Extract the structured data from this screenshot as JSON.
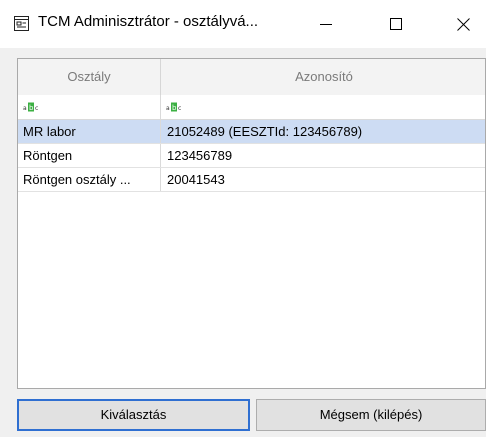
{
  "window": {
    "title": "TCM Adminisztrátor - osztályvá...",
    "icon": "app-window-icon",
    "controls": {
      "minimize": "minimize-icon",
      "maximize": "maximize-icon",
      "close": "close-icon"
    }
  },
  "grid": {
    "columns": [
      "Osztály",
      "Azonosító"
    ],
    "filter_icon": "abc-filter-icon",
    "rows": [
      {
        "osztaly": "MR labor",
        "azonosito": "21052489 (EESZTId: 123456789)",
        "selected": true
      },
      {
        "osztaly": "Röntgen",
        "azonosito": "123456789",
        "selected": false
      },
      {
        "osztaly": "Röntgen osztály ...",
        "azonosito": "20041543",
        "selected": false
      }
    ],
    "selection_color": "#cddcf3"
  },
  "buttons": {
    "select": "Kiválasztás",
    "cancel": "Mégsem (kilépés)"
  },
  "colors": {
    "focus_border": "#2f6fd1"
  }
}
